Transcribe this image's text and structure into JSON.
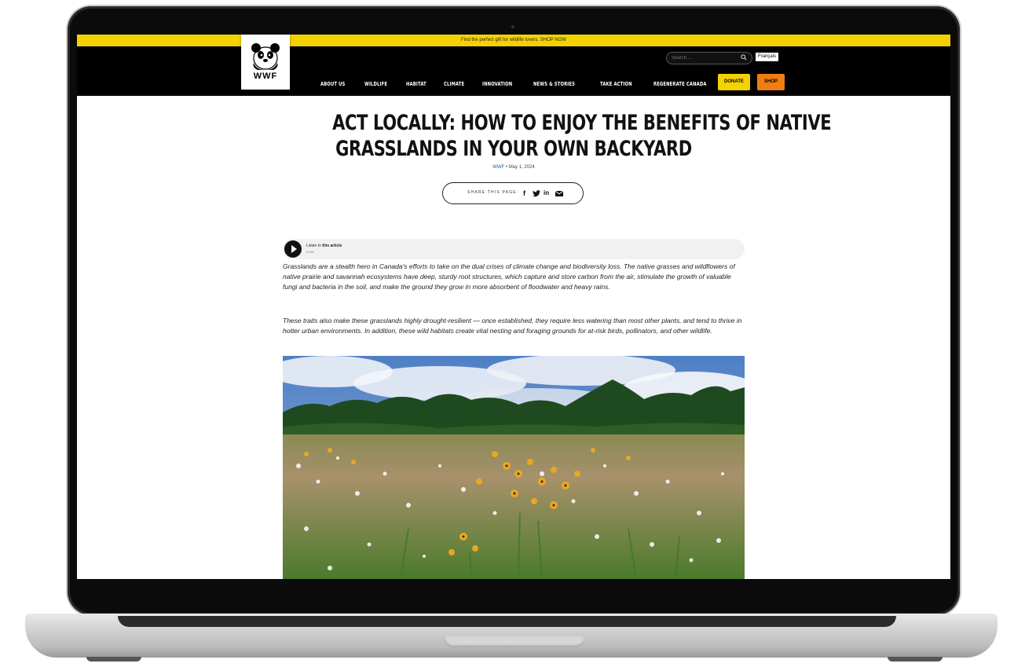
{
  "promo": {
    "text": "Find the perfect gift for wildlife lovers. SHOP NOW"
  },
  "logo": {
    "text": "WWF"
  },
  "search": {
    "placeholder": "Search ..."
  },
  "language": {
    "label": "Français"
  },
  "nav": {
    "items": [
      "ABOUT US",
      "WILDLIFE",
      "HABITAT",
      "CLIMATE",
      "INNOVATION",
      "NEWS & STORIES",
      "TAKE ACTION",
      "REGENERATE CANADA"
    ],
    "donate_label": "DONATE",
    "shop_label": "SHOP"
  },
  "article": {
    "title_line1": "ACT LOCALLY: HOW TO ENJOY THE BENEFITS OF NATIVE",
    "title_line2": "GRASSLANDS IN YOUR OWN BACKYARD",
    "author": "WWF",
    "date": "• May 1, 2024",
    "share_label": "SHARE THIS PAGE:",
    "share_icons": [
      "facebook-icon",
      "twitter-icon",
      "linkedin-icon",
      "email-icon"
    ],
    "audio": {
      "label_prefix": "Listen to",
      "label_bold": "this article",
      "duration": "3 min"
    },
    "paragraphs": [
      "Grasslands are a stealth hero in Canada's efforts to take on the dual crises of climate change and biodiversity loss. The native grasses and wildflowers of native prairie and savannah ecosystems have deep, sturdy root structures, which capture and store carbon from the air, stimulate the growth of valuable fungi and bacteria in the soil, and make the ground they grow in more absorbent of floodwater and heavy rains.",
      "These traits also make these grasslands highly drought-resilient — once established, they require less watering than most other plants, and tend to thrive in hotter urban environments. In addition, these wild habitats create vital nesting and foraging grounds for at-risk birds, pollinators, and other wildlife."
    ]
  },
  "colors": {
    "accent_yellow": "#f4d200",
    "shop_orange": "#f07d12",
    "header_black": "#000000"
  }
}
